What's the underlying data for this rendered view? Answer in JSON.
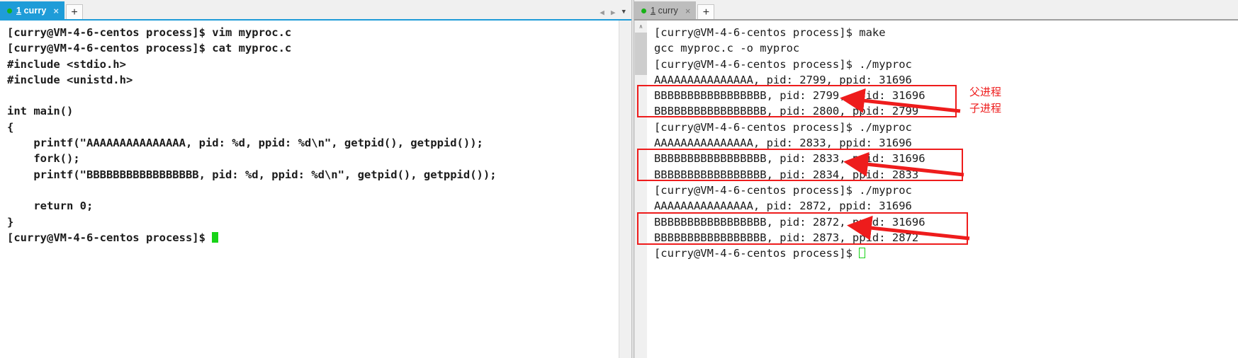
{
  "window": {
    "left_pane": {
      "tab": {
        "mnemonic": "1",
        "label": " curry",
        "close_glyph": "×",
        "status_dot": "green",
        "active": true
      },
      "new_tab_label": "+",
      "nav": {
        "prev_glyph": "◀",
        "next_glyph": "▶",
        "menu_glyph": "▼"
      },
      "lines": [
        "[curry@VM-4-6-centos process]$ vim myproc.c",
        "[curry@VM-4-6-centos process]$ cat myproc.c",
        "#include <stdio.h>",
        "#include <unistd.h>",
        "",
        "int main()",
        "{",
        "    printf(\"AAAAAAAAAAAAAAA, pid: %d, ppid: %d\\n\", getpid(), getppid());",
        "    fork();",
        "    printf(\"BBBBBBBBBBBBBBBBB, pid: %d, ppid: %d\\n\", getpid(), getppid());",
        "",
        "    return 0;",
        "}"
      ],
      "prompt_line": "[curry@VM-4-6-centos process]$ ",
      "cursor_style": "filled"
    },
    "right_pane": {
      "tab": {
        "mnemonic": "1",
        "label": " curry",
        "close_glyph": "×",
        "status_dot": "green",
        "active": false
      },
      "new_tab_label": "+",
      "lines": [
        "[curry@VM-4-6-centos process]$ make",
        "gcc myproc.c -o myproc",
        "[curry@VM-4-6-centos process]$ ./myproc",
        "AAAAAAAAAAAAAAA, pid: 2799, ppid: 31696",
        "BBBBBBBBBBBBBBBBB, pid: 2799, ppid: 31696",
        "BBBBBBBBBBBBBBBBB, pid: 2800, ppid: 2799",
        "[curry@VM-4-6-centos process]$ ./myproc",
        "AAAAAAAAAAAAAAA, pid: 2833, ppid: 31696",
        "BBBBBBBBBBBBBBBBB, pid: 2833, ppid: 31696",
        "BBBBBBBBBBBBBBBBB, pid: 2834, ppid: 2833",
        "[curry@VM-4-6-centos process]$ ./myproc",
        "AAAAAAAAAAAAAAA, pid: 2872, ppid: 31696",
        "BBBBBBBBBBBBBBBBB, pid: 2872, ppid: 31696",
        "BBBBBBBBBBBBBBBBB, pid: 2873, ppid: 2872"
      ],
      "prompt_line": "[curry@VM-4-6-centos process]$ ",
      "cursor_style": "hollow",
      "scrollbar": {
        "up_glyph": "∧",
        "down_glyph": "∨"
      }
    }
  },
  "annotations": {
    "highlight_color": "#ee1c1c",
    "labels": [
      {
        "text": "父进程"
      },
      {
        "text": "子进程"
      }
    ]
  }
}
